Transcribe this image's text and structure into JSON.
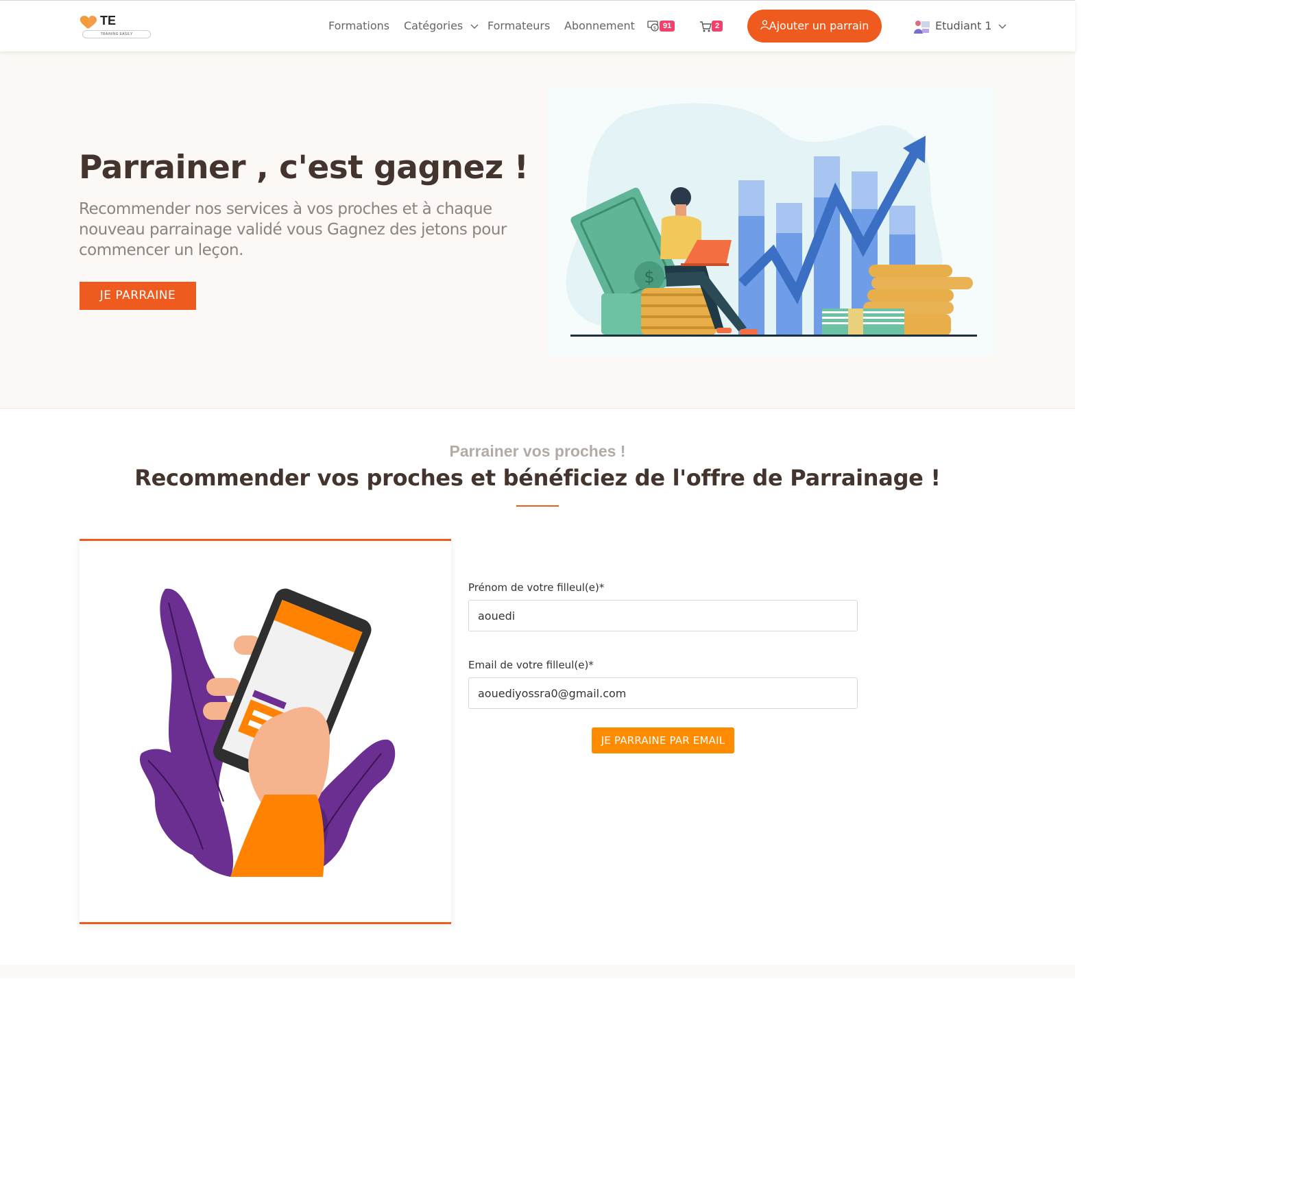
{
  "nav": {
    "logo_text": "TE",
    "logo_tagline": "TRAINING EASILY",
    "links": {
      "formations": "Formations",
      "categories": "Catégories",
      "formateurs": "Formateurs",
      "abonnement": "Abonnement"
    },
    "tokens_badge": "91",
    "cart_badge": "2",
    "add_sponsor_button": "Ajouter un parrain",
    "user_name": "Etudiant 1"
  },
  "hero": {
    "title": "Parrainer , c'est gagnez !",
    "text": "Recommender nos services à vos proches et à chaque nouveau parrainage validé vous Gagnez des jetons pour commencer un leçon.",
    "button": "JE PARRAINE"
  },
  "section": {
    "subtitle": "Parrainer vos proches !",
    "title": "Recommender vos proches et bénéficiez de l'offre de Parrainage !"
  },
  "form": {
    "first_name_label": "Prénom de votre filleul(e)*",
    "first_name_value": "aouedi",
    "email_label": "Email de votre filleul(e)*",
    "email_value": "aouediyossra0@gmail.com",
    "submit": "JE PARRAINE PAR EMAIL"
  },
  "colors": {
    "accent": "#ef5a1f",
    "submit": "#ff8b00",
    "badge": "#f0426a",
    "heading": "#44342e"
  }
}
